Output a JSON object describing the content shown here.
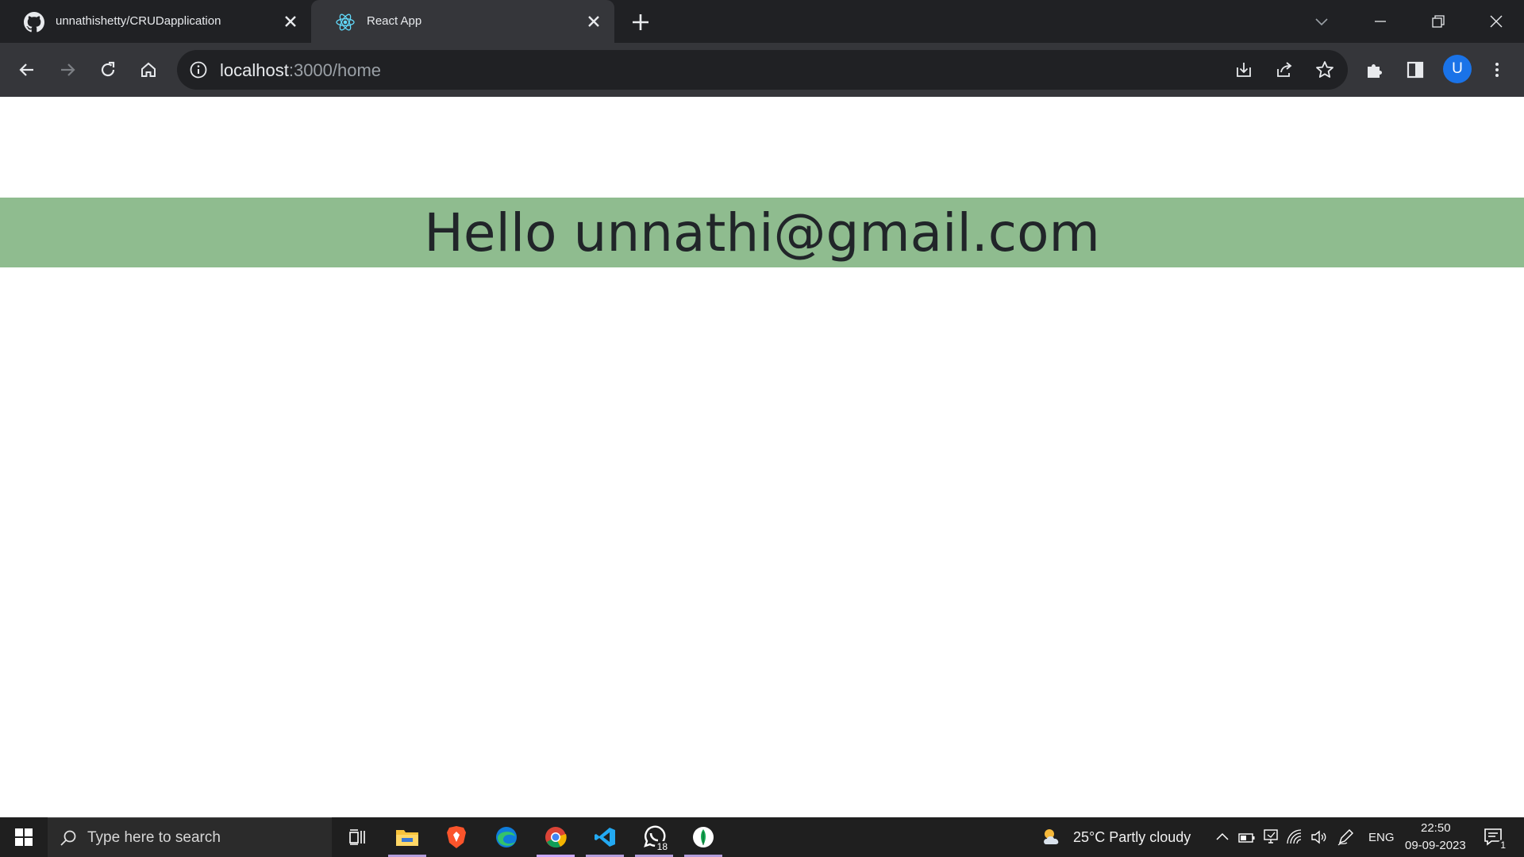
{
  "browser": {
    "tabs": [
      {
        "title": "unnathishetty/CRUDapplication",
        "icon": "github-icon",
        "active": false
      },
      {
        "title": "React App",
        "icon": "react-icon",
        "active": true
      }
    ],
    "address": {
      "host": "localhost",
      "rest": ":3000/home"
    },
    "profile_initial": "U"
  },
  "page": {
    "greeting": "Hello unnathi@gmail.com",
    "banner_color": "#8fbc8f"
  },
  "taskbar": {
    "search_placeholder": "Type here to search",
    "apps": [
      "task-view-icon",
      "file-explorer-icon",
      "brave-icon",
      "edge-icon",
      "chrome-icon",
      "vscode-icon",
      "whatsapp-icon",
      "mongodb-compass-icon"
    ],
    "whatsapp_badge": "18",
    "weather": "25°C  Partly cloudy",
    "language": "ENG",
    "time": "22:50",
    "date": "09-09-2023",
    "notification_count": "1"
  }
}
